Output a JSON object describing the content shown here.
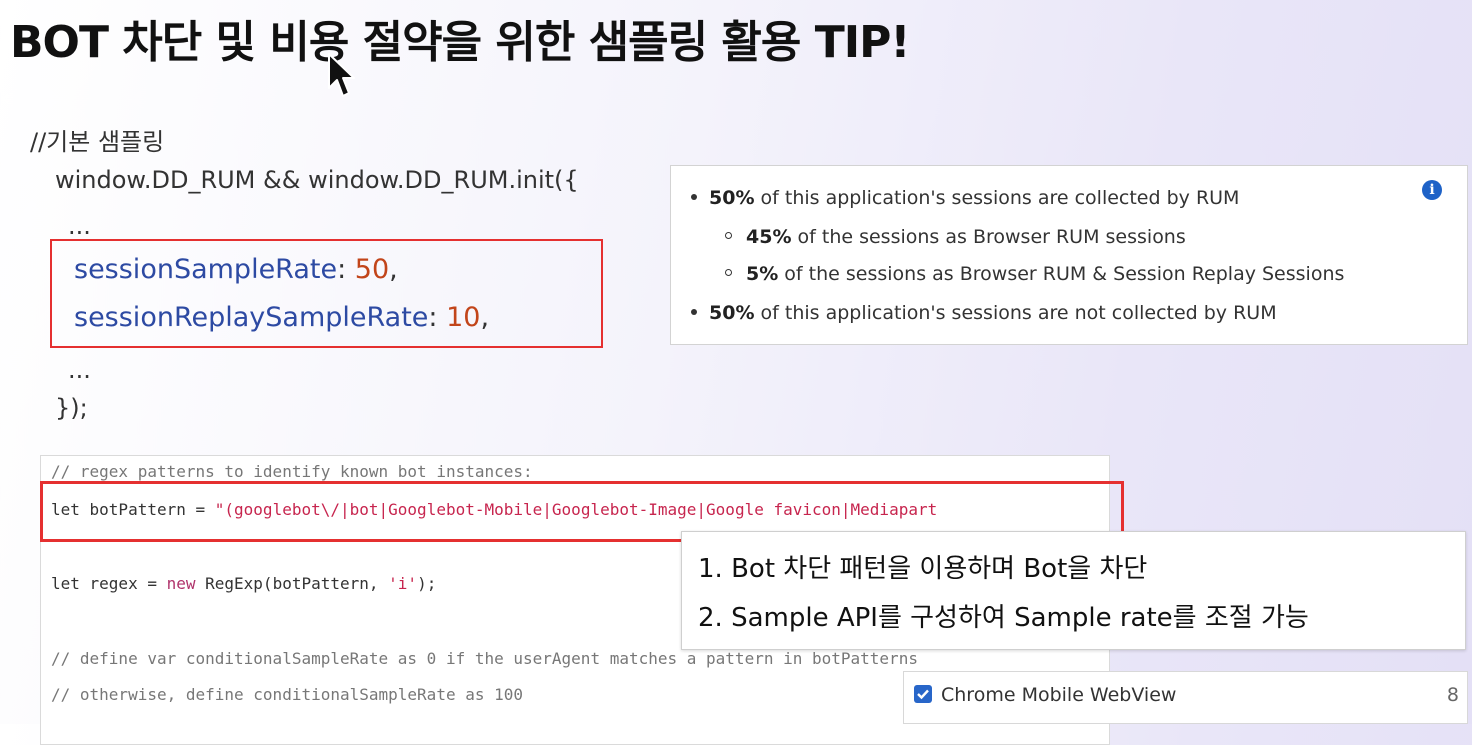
{
  "slide": {
    "title": "BOT 차단 및 비용 절약을 위한 샘플링 활용 TIP!"
  },
  "rum_config": {
    "comment": "//기본 샘플링",
    "init_line": "window.DD_RUM && window.DD_RUM.init({",
    "ellipsis1": "...",
    "session_key": "sessionSampleRate",
    "session_value": "50",
    "replay_key": "sessionReplaySampleRate",
    "replay_value": "10",
    "ellipsis2": "...",
    "close_line": "});"
  },
  "info_panel": {
    "bullet1_bold": "50%",
    "bullet1_text": " of this application's sessions are collected by RUM",
    "sub1_bold": "45%",
    "sub1_text": " of the sessions as Browser RUM sessions",
    "sub2_bold": "5%",
    "sub2_text": " of the sessions as Browser RUM & Session Replay Sessions",
    "bullet2_bold": "50%",
    "bullet2_text": " of this application's sessions are not collected by RUM",
    "icon": "info-icon"
  },
  "code_panel": {
    "line1": "// regex patterns to identify known bot instances:",
    "line2_prefix": "let botPattern = ",
    "line2_string": "\"(googlebot\\/|bot|Googlebot-Mobile|Googlebot-Image|Google favicon|Mediapart",
    "line3_prefix": "let regex = ",
    "line3_kw": "new",
    "line3_mid": " RegExp(botPattern, ",
    "line3_str": "'i'",
    "line3_end": ");",
    "line4": "// define var conditionalSampleRate as 0 if the userAgent matches a pattern in botPatterns",
    "line5": "// otherwise, define conditionalSampleRate as 100"
  },
  "tips": {
    "tip1": "1. Bot 차단 패턴을 이용하며 Bot을 차단",
    "tip2": "2. Sample API를 구성하여 Sample rate를 조절 가능"
  },
  "filter_row": {
    "label": "Chrome Mobile WebView",
    "count": "8",
    "checked": true
  },
  "colors": {
    "highlight_border": "#e53030",
    "key_color": "#2d4aa3",
    "value_color": "#c2451a",
    "checkbox": "#2866c9"
  }
}
